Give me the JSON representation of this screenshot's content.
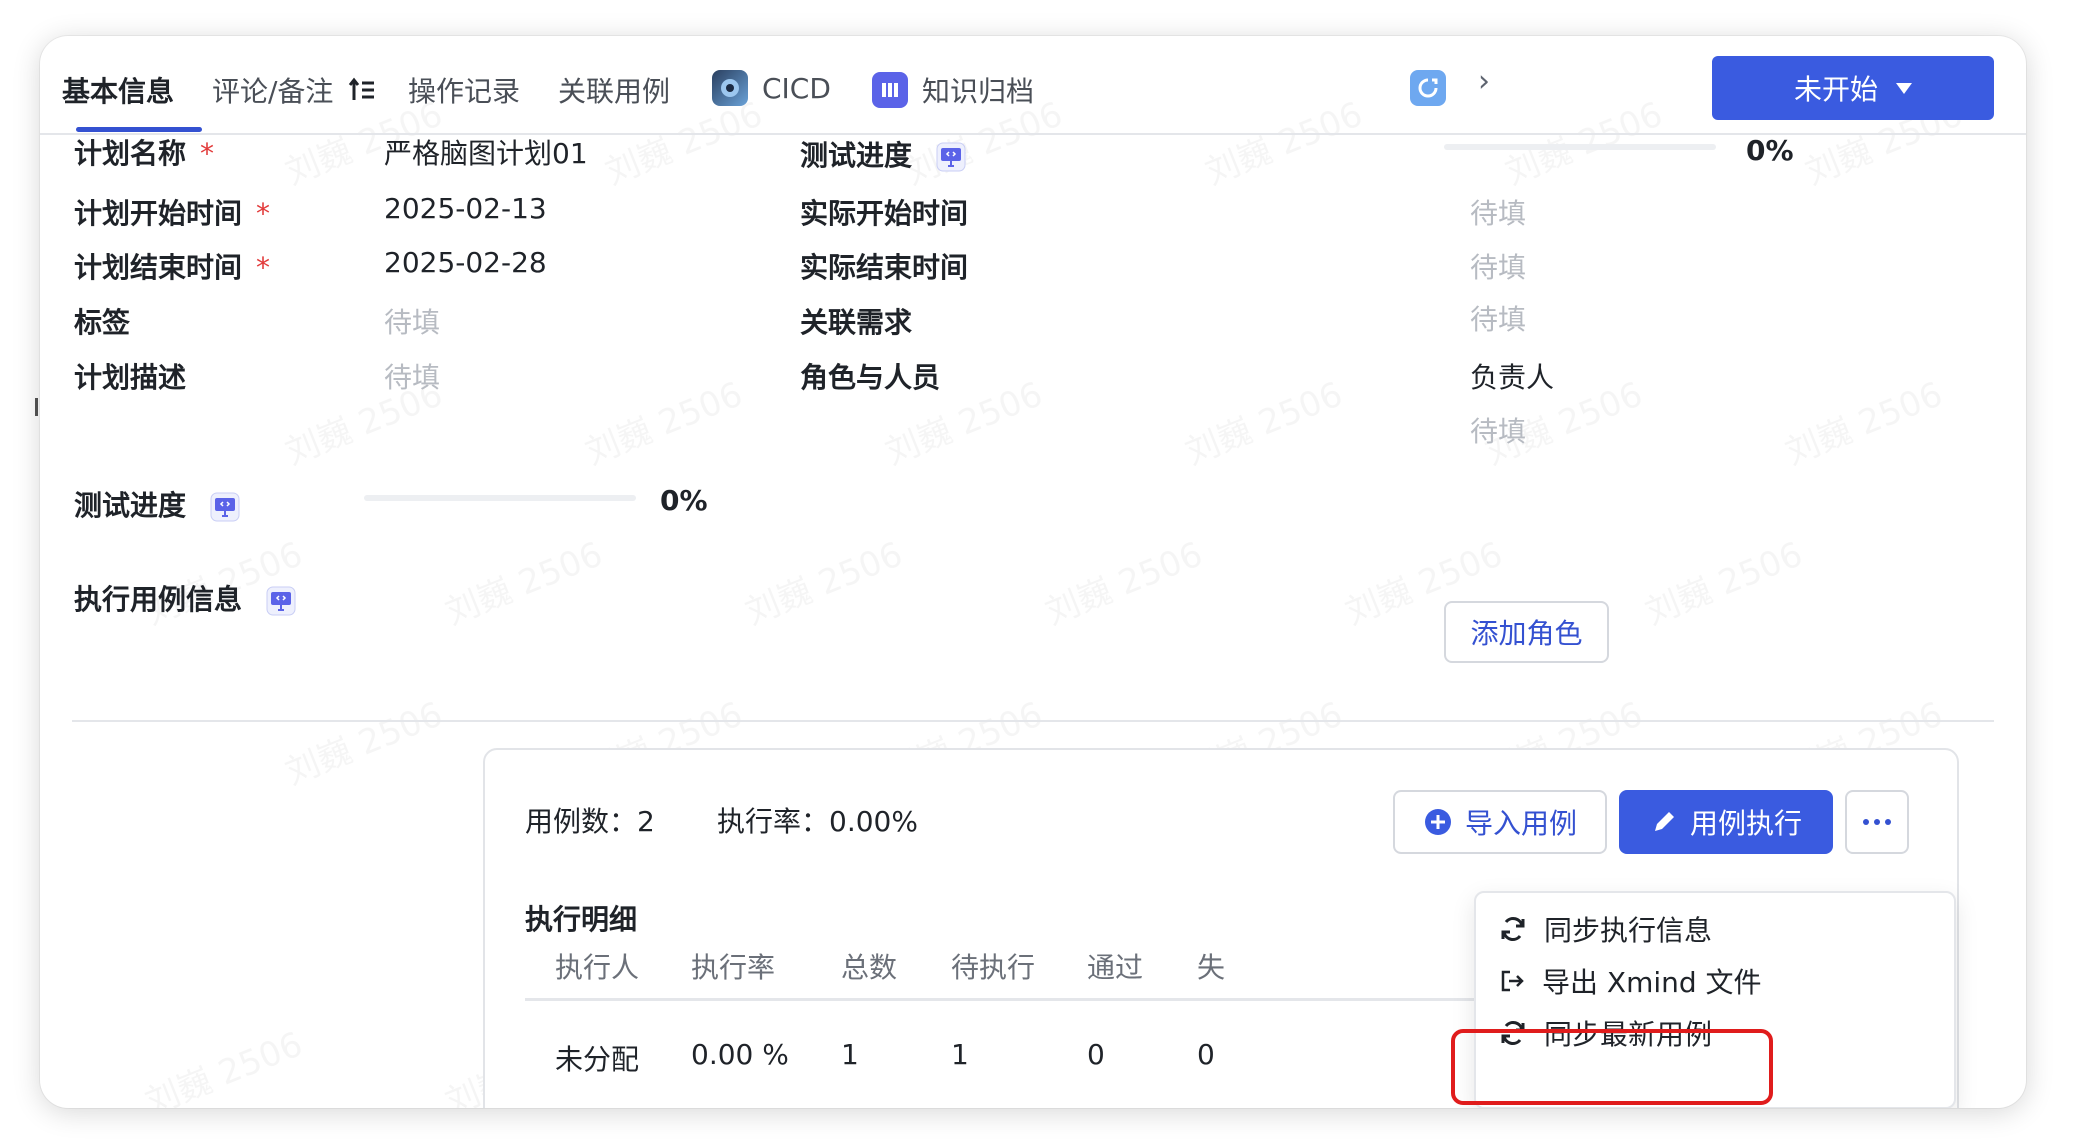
{
  "tabs": [
    {
      "label": "基本信息",
      "active": true
    },
    {
      "label": "评论/备注"
    },
    {
      "label": "操作记录"
    },
    {
      "label": "关联用例"
    },
    {
      "label": "CICD"
    },
    {
      "label": "知识归档"
    }
  ],
  "status_button": {
    "label": "未开始"
  },
  "fields": {
    "plan_name": {
      "label": "计划名称",
      "required": "*",
      "value": "严格脑图计划01"
    },
    "plan_start": {
      "label": "计划开始时间",
      "required": "*",
      "value": "2025-02-13"
    },
    "plan_end": {
      "label": "计划结束时间",
      "required": "*",
      "value": "2025-02-28"
    },
    "tags": {
      "label": "标签",
      "value": "待填"
    },
    "desc": {
      "label": "计划描述",
      "value": "待填"
    },
    "progress_right": {
      "label": "测试进度",
      "value": "0%"
    },
    "actual_start": {
      "label": "实际开始时间",
      "value": "待填"
    },
    "actual_end": {
      "label": "实际结束时间",
      "value": "待填"
    },
    "related_req": {
      "label": "关联需求",
      "value": "待填"
    },
    "roles": {
      "label": "角色与人员",
      "role_name": "负责人",
      "role_value": "待填",
      "add_role": "添加角色"
    },
    "progress_left": {
      "label": "测试进度",
      "value": "0%"
    }
  },
  "exec": {
    "label": "执行用例信息",
    "case_count": "用例数：2",
    "exec_rate": "执行率：0.00%",
    "import_btn": "导入用例",
    "execute_btn": "用例执行",
    "detail_title": "执行明细",
    "columns": [
      "执行人",
      "执行率",
      "总数",
      "待执行",
      "通过",
      "失"
    ],
    "rows": [
      [
        "未分配",
        "0.00 %",
        "1",
        "1",
        "0",
        "0"
      ]
    ]
  },
  "menu": {
    "items": [
      "同步执行信息",
      "导出 Xmind 文件",
      "同步最新用例"
    ]
  },
  "watermark": "刘巍 2506",
  "colors": {
    "primary": "#3a5be0",
    "highlight": "#e01c1c",
    "required": "#e23b3b"
  }
}
